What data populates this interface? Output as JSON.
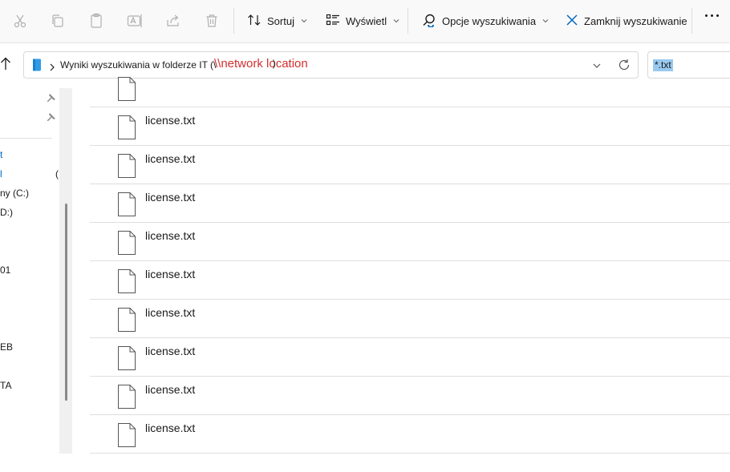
{
  "toolbar": {
    "cut_icon": "scissors-icon",
    "copy_icon": "copy-icon",
    "paste_icon": "clipboard-icon",
    "rename_icon": "rename-icon",
    "share_icon": "share-icon",
    "delete_icon": "trash-icon",
    "sort_label": "Sortuj",
    "view_label": "Wyświetl",
    "search_options_label": "Opcje wyszukiwania",
    "close_search_label": "Zamknij wyszukiwanie",
    "more_icon": "more-dots-icon"
  },
  "address": {
    "path_text": "Wyniki wyszukiwania w folderze IT (\\",
    "network_annotation": "\\\\network location",
    "closing_paren": ")"
  },
  "search": {
    "query": "*.txt"
  },
  "nav": {
    "items": [
      {
        "label": "t"
      },
      {
        "label": "l"
      },
      {
        "label": "("
      },
      {
        "label": "ny (C:)"
      },
      {
        "label": "D:)"
      },
      {
        "label": "01"
      },
      {
        "label": "EB"
      },
      {
        "label": "TA"
      }
    ]
  },
  "files": [
    {
      "name": ""
    },
    {
      "name": "license.txt"
    },
    {
      "name": "license.txt"
    },
    {
      "name": "license.txt"
    },
    {
      "name": "license.txt"
    },
    {
      "name": "license.txt"
    },
    {
      "name": "license.txt"
    },
    {
      "name": "license.txt"
    },
    {
      "name": "license.txt"
    },
    {
      "name": "license.txt"
    }
  ],
  "colors": {
    "accent": "#0067c0",
    "annotation": "#d32f2f",
    "selection": "#99c9ef"
  }
}
